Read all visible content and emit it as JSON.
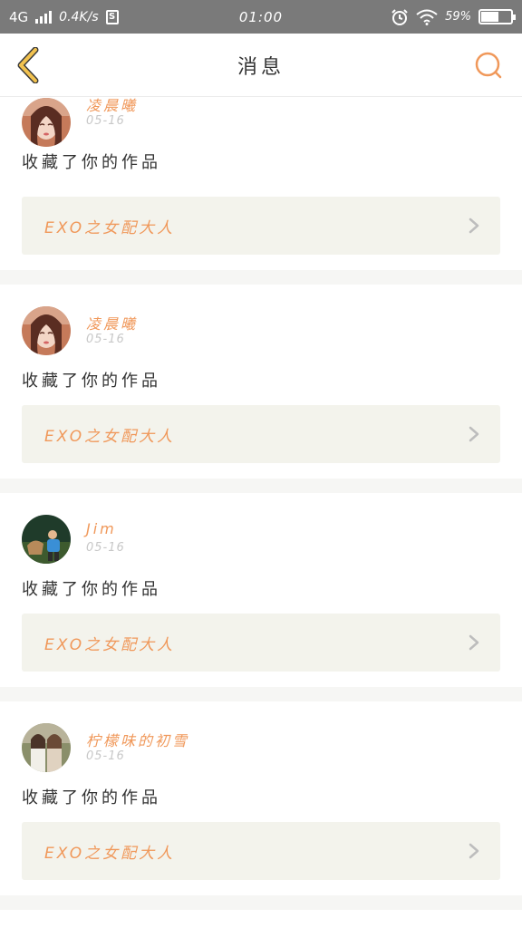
{
  "status_bar": {
    "network": "4G",
    "speed": "0.4K/s",
    "s_badge": "S",
    "time": "01:00",
    "battery_percent": "59%",
    "battery_level": 0.59
  },
  "header": {
    "title": "消息",
    "back_icon": "chevron-left-icon",
    "search_icon": "search-icon"
  },
  "colors": {
    "accent": "#f0985a",
    "back_arrow": "#f2c24f",
    "status_bar_bg": "#7a7a7a",
    "card_link_bg": "#f3f3ec"
  },
  "messages": [
    {
      "name": "凌晨曦",
      "date": "05-16",
      "action": "收藏了你的作品",
      "work_title": "EXO之女配大人"
    },
    {
      "name": "凌晨曦",
      "date": "05-16",
      "action": "收藏了你的作品",
      "work_title": "EXO之女配大人"
    },
    {
      "name": "Jim",
      "date": "05-16",
      "action": "收藏了你的作品",
      "work_title": "EXO之女配大人"
    },
    {
      "name": "柠檬味的初雪",
      "date": "05-16",
      "action": "收藏了你的作品",
      "work_title": "EXO之女配大人"
    }
  ]
}
